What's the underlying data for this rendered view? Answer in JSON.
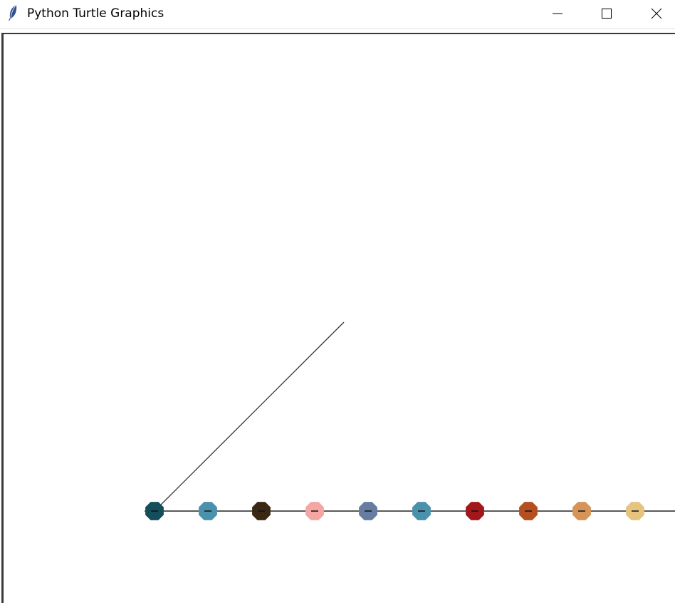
{
  "window": {
    "title": "Python Turtle Graphics",
    "icon": "feather-icon",
    "controls": [
      "minimize-icon",
      "maximize-icon",
      "close-icon"
    ]
  },
  "canvas": {
    "background": "#ffffff",
    "line_color": "#222222",
    "dots": [
      {
        "color": "#134e5a"
      },
      {
        "color": "#4a92ab"
      },
      {
        "color": "#3a2815"
      },
      {
        "color": "#f4a6a3"
      },
      {
        "color": "#667da1"
      },
      {
        "color": "#4a92ab"
      },
      {
        "color": "#a2171b"
      },
      {
        "color": "#b4501f"
      },
      {
        "color": "#d69458"
      },
      {
        "color": "#e6c47f"
      }
    ]
  }
}
